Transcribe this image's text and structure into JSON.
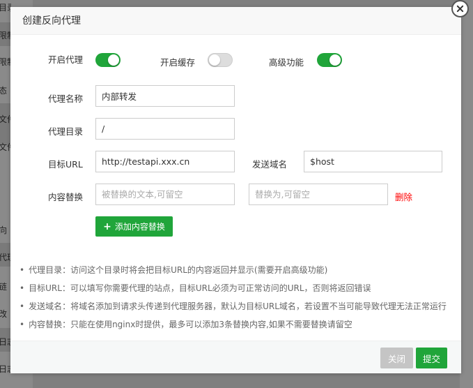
{
  "background": {
    "items": [
      "目录",
      "限制",
      "限制",
      "态",
      "文件",
      "文件",
      "向",
      "代理",
      "链",
      "改",
      "日志",
      "日志"
    ]
  },
  "dialog": {
    "title": "创建反向代理",
    "toggles": {
      "proxy": {
        "label": "开启代理",
        "on": true
      },
      "cache": {
        "label": "开启缓存",
        "on": false
      },
      "advanced": {
        "label": "高级功能",
        "on": true
      }
    },
    "fields": {
      "proxy_name": {
        "label": "代理名称",
        "value": "内部转发"
      },
      "proxy_dir": {
        "label": "代理目录",
        "value": "/"
      },
      "target_url": {
        "label": "目标URL",
        "value": "http://testapi.xxx.cn"
      },
      "send_domain": {
        "label": "发送域名",
        "value": "$host"
      },
      "replace": {
        "label": "内容替换",
        "from_placeholder": "被替换的文本,可留空",
        "to_placeholder": "替换为,可留空",
        "delete_label": "删除"
      }
    },
    "add_replace_label": "添加内容替换",
    "tips": [
      "代理目录：访问这个目录时将会把目标URL的内容返回并显示(需要开启高级功能)",
      "目标URL：可以填写你需要代理的站点，目标URL必须为可正常访问的URL，否则将返回错误",
      "发送域名：将域名添加到请求头传递到代理服务器，默认为目标URL域名，若设置不当可能导致代理无法正常运行",
      "内容替换：只能在使用nginx时提供，最多可以添加3条替换内容,如果不需要替换请留空"
    ],
    "footer": {
      "close_label": "关闭",
      "submit_label": "提交"
    },
    "colors": {
      "accent": "#20a53a",
      "danger": "#ff0000",
      "disabled": "#c5c5c5"
    }
  }
}
